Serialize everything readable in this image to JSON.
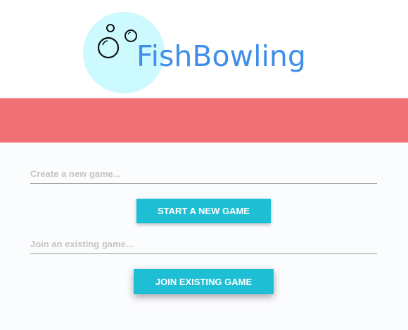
{
  "header": {
    "logo_text": "FishBowling",
    "logo_icon": "bubbles-icon",
    "logo_circle_color": "#ccfaff",
    "logo_text_color": "#3f8ee9"
  },
  "banner": {
    "color": "#f07074"
  },
  "create_game": {
    "placeholder": "Create a new game...",
    "value": "",
    "button_label": "START A NEW GAME"
  },
  "join_game": {
    "placeholder": "Join an existing game...",
    "value": "",
    "button_label": "JOIN EXISTING GAME"
  },
  "colors": {
    "button": "#1ebfd4",
    "background": "#fbfcfe"
  }
}
